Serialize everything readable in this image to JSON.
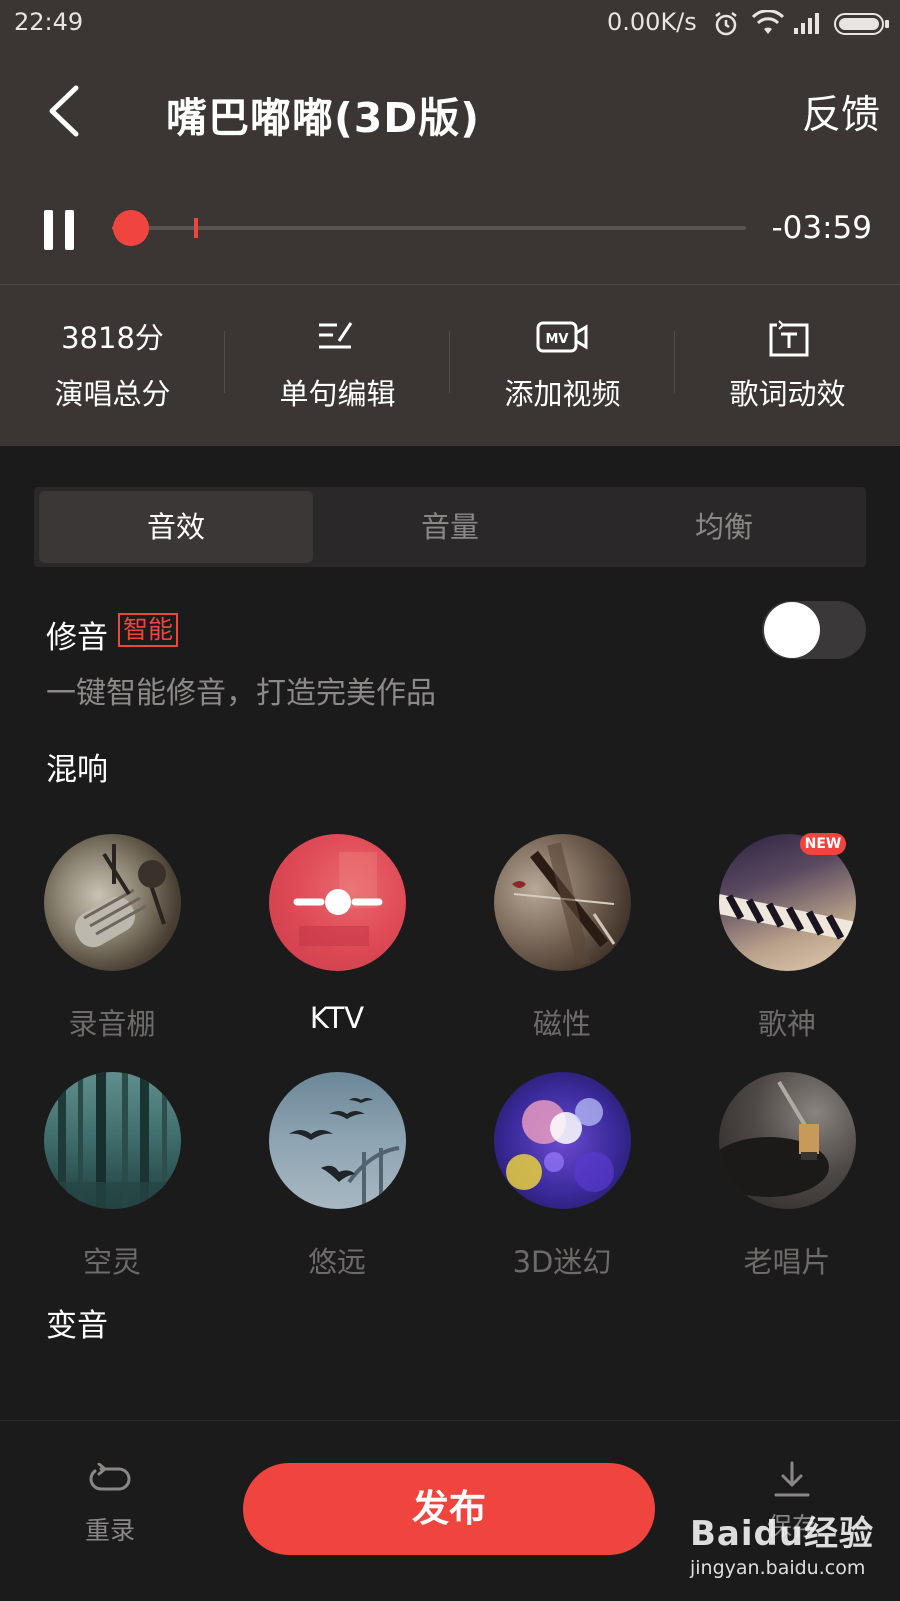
{
  "status_bar": {
    "time": "22:49",
    "network_speed": "0.00K/s",
    "icons": [
      "alarm-icon",
      "wifi-icon",
      "signal-icon",
      "battery-icon"
    ]
  },
  "header": {
    "title": "嘴巴嘟嘟(3D版)",
    "feedback_label": "反馈"
  },
  "player": {
    "state": "playing",
    "progress_fraction": 0.03,
    "remaining_time": "-03:59",
    "accent_color": "#f0443e"
  },
  "tools": [
    {
      "value": "3818分",
      "label": "演唱总分"
    },
    {
      "icon": "edit-lines-icon",
      "label": "单句编辑"
    },
    {
      "icon": "mv-camera-icon",
      "label": "添加视频"
    },
    {
      "icon": "lyric-effect-icon",
      "label": "歌词动效"
    }
  ],
  "tabs": [
    {
      "label": "音效",
      "active": true
    },
    {
      "label": "音量",
      "active": false
    },
    {
      "label": "均衡",
      "active": false
    }
  ],
  "pitch_fix": {
    "label": "修音",
    "badge": "智能",
    "description": "一键智能修音，打造完美作品",
    "enabled": false
  },
  "reverb": {
    "section_title": "混响",
    "effects": [
      {
        "label": "录音棚",
        "selected": false
      },
      {
        "label": "KTV",
        "selected": true
      },
      {
        "label": "磁性",
        "selected": false
      },
      {
        "label": "歌神",
        "selected": false,
        "badge": "NEW"
      },
      {
        "label": "空灵",
        "selected": false
      },
      {
        "label": "悠远",
        "selected": false
      },
      {
        "label": "3D迷幻",
        "selected": false
      },
      {
        "label": "老唱片",
        "selected": false
      }
    ]
  },
  "voice_change": {
    "section_title": "变音"
  },
  "bottom_bar": {
    "rerecord_label": "重录",
    "publish_label": "发布",
    "save_label": "保存"
  },
  "watermark": {
    "brand": "Baidu经验",
    "url": "jingyan.baidu.com"
  }
}
